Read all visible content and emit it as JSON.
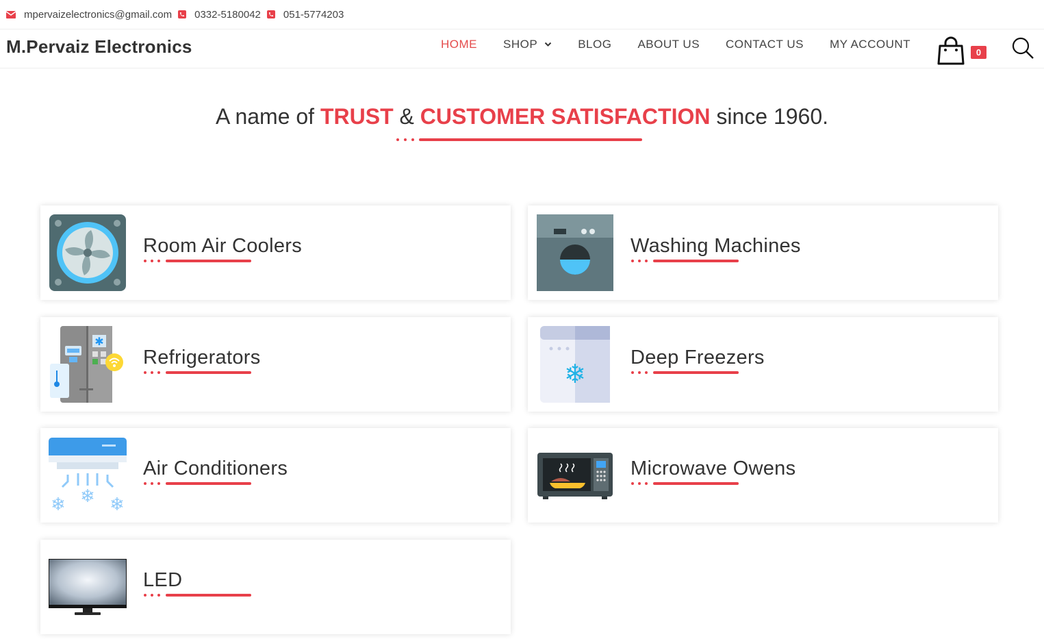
{
  "topbar": {
    "email": "mpervaizelectronics@gmail.com",
    "phone1": "0332-5180042",
    "phone2": "051-5774203"
  },
  "header": {
    "brand": "M.Pervaiz Electronics",
    "nav": {
      "home": "HOME",
      "shop": "SHOP",
      "blog": "BLOG",
      "about": "ABOUT US",
      "contact": "CONTACT US",
      "account": "MY ACCOUNT"
    },
    "cart_count": "0"
  },
  "headline": {
    "part1": "A name of ",
    "trust": "TRUST",
    "amp": " & ",
    "satisfaction": "CUSTOMER SATISFACTION",
    "part2": " since 1960."
  },
  "categories": [
    {
      "title": "Room Air Coolers",
      "icon": "air-cooler-icon"
    },
    {
      "title": "Washing Machines",
      "icon": "washing-machine-icon"
    },
    {
      "title": "Refrigerators",
      "icon": "refrigerator-icon"
    },
    {
      "title": "Deep Freezers",
      "icon": "deep-freezer-icon"
    },
    {
      "title": "Air Conditioners",
      "icon": "air-conditioner-icon"
    },
    {
      "title": "Microwave Owens",
      "icon": "microwave-icon"
    },
    {
      "title": "LED",
      "icon": "led-tv-icon"
    }
  ],
  "colors": {
    "accent": "#e8404a",
    "text": "#333333"
  }
}
